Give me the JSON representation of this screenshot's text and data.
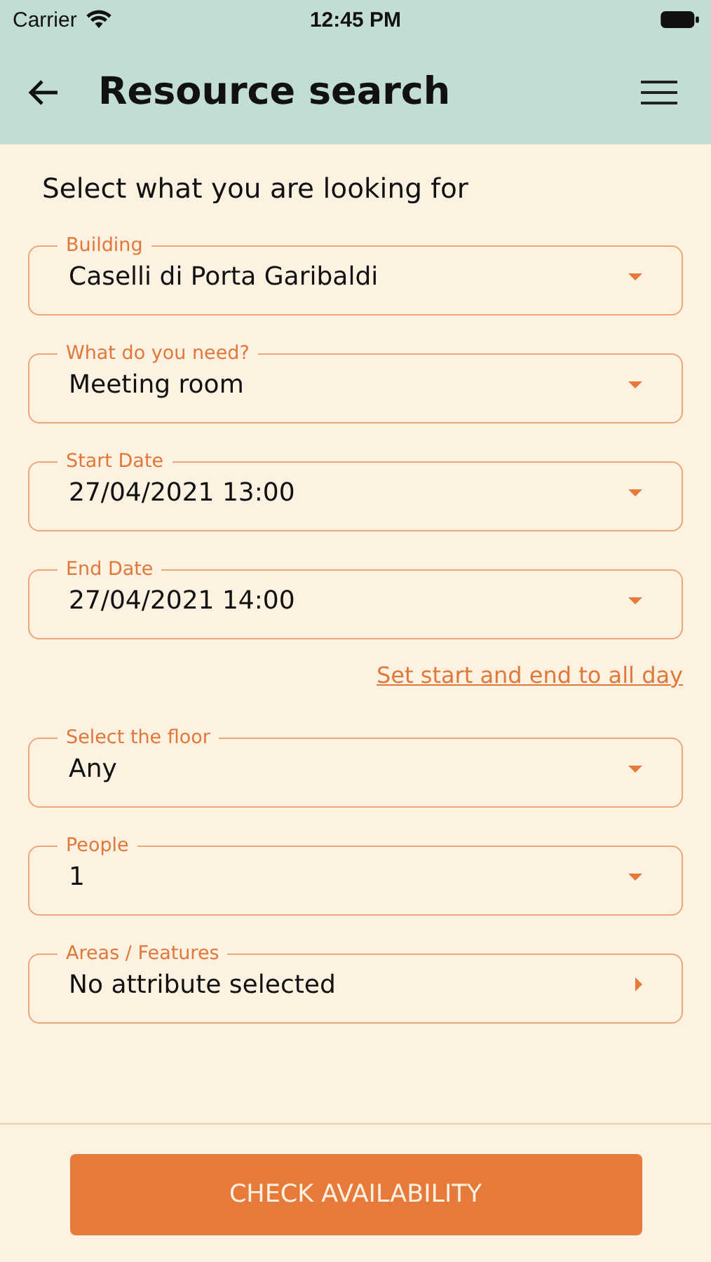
{
  "status_bar": {
    "carrier": "Carrier",
    "time": "12:45 PM"
  },
  "header": {
    "title": "Resource search"
  },
  "heading": "Select what you are looking for",
  "fields": [
    {
      "kind": "dropdown",
      "label": "Building",
      "value": "Caselli di Porta Garibaldi"
    },
    {
      "kind": "dropdown",
      "label": "What do you need?",
      "value": "Meeting room"
    },
    {
      "kind": "dropdown",
      "label": "Start Date",
      "value": "27/04/2021 13:00"
    },
    {
      "kind": "dropdown",
      "label": "End Date",
      "value": "27/04/2021 14:00"
    },
    {
      "kind": "link",
      "text": "Set start and end to all day"
    },
    {
      "kind": "dropdown",
      "label": "Select the floor",
      "value": "Any"
    },
    {
      "kind": "dropdown",
      "label": "People",
      "value": "1"
    },
    {
      "kind": "navigate",
      "label": "Areas / Features",
      "value": "No attribute selected"
    }
  ],
  "button": "CHECK AVAILABILITY"
}
